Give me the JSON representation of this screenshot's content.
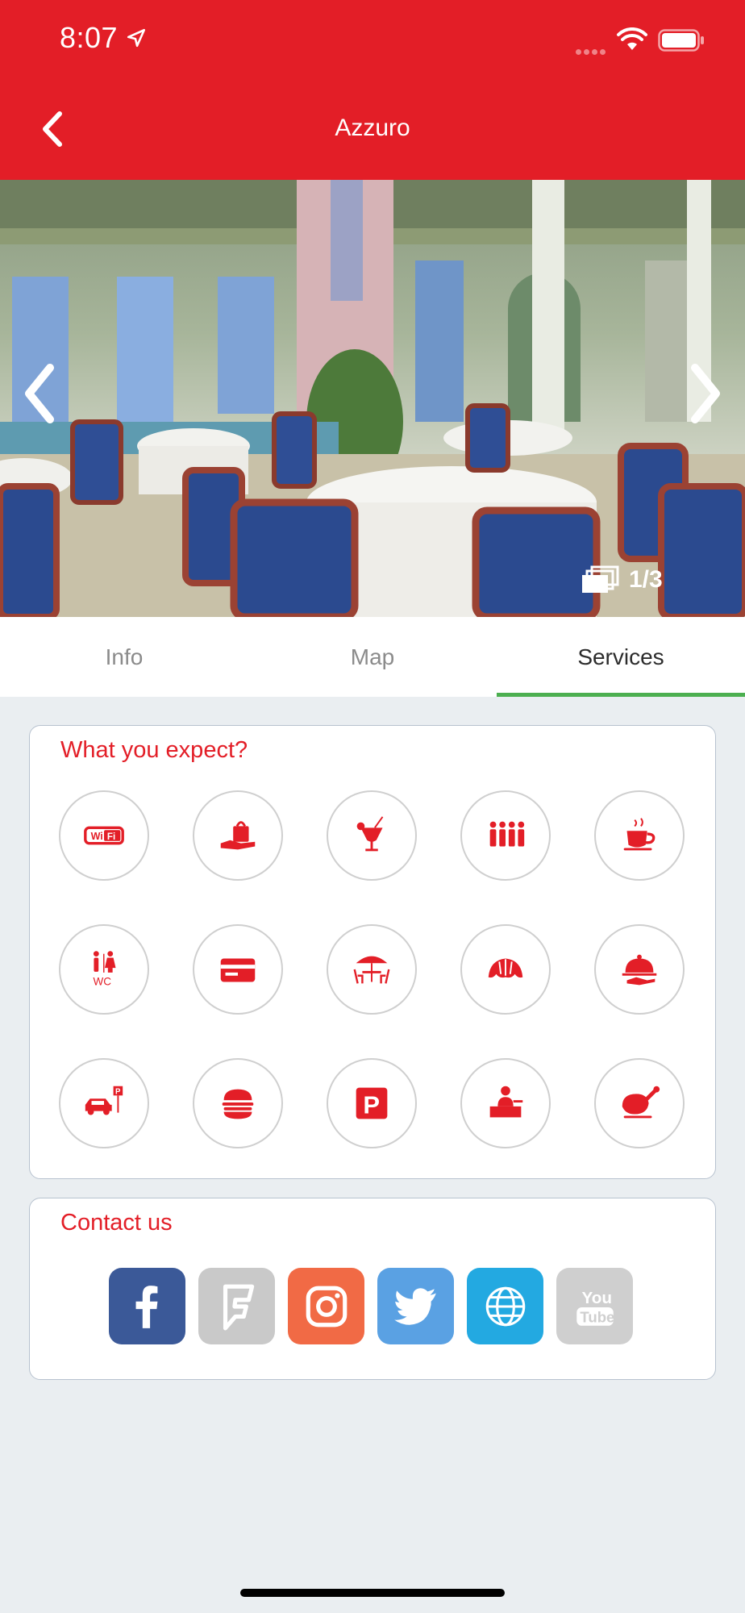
{
  "status_bar": {
    "time": "8:07"
  },
  "header": {
    "title": "Azzuro",
    "back_icon": "chevron-left-icon"
  },
  "gallery": {
    "counter": "1/3",
    "prev_icon": "chevron-left-icon",
    "next_icon": "chevron-right-icon"
  },
  "tabs": [
    {
      "label": "Info",
      "active": false
    },
    {
      "label": "Map",
      "active": false
    },
    {
      "label": "Services",
      "active": true
    }
  ],
  "services_card": {
    "title": "What you expect?",
    "icons": [
      "wifi-icon",
      "takeaway-bag-icon",
      "cocktail-icon",
      "group-people-icon",
      "coffee-cup-icon",
      "restroom-wc-icon",
      "credit-card-icon",
      "outdoor-seating-icon",
      "croissant-icon",
      "room-service-cloche-icon",
      "car-parking-icon",
      "burger-icon",
      "parking-sign-icon",
      "reception-desk-icon",
      "roast-chicken-icon"
    ]
  },
  "contact_card": {
    "title": "Contact us",
    "links": [
      {
        "name": "facebook-icon",
        "color": "#3b5998"
      },
      {
        "name": "foursquare-icon",
        "color": "#c9c9c9"
      },
      {
        "name": "instagram-icon",
        "color": "#f16a45"
      },
      {
        "name": "twitter-icon",
        "color": "#5aa1e3"
      },
      {
        "name": "website-globe-icon",
        "color": "#23a9e1"
      },
      {
        "name": "youtube-icon",
        "color": "#cfcfcf"
      }
    ]
  },
  "colors": {
    "brand_red": "#e31e27",
    "active_tab_underline": "#4caf50",
    "background": "#eaeef1"
  }
}
